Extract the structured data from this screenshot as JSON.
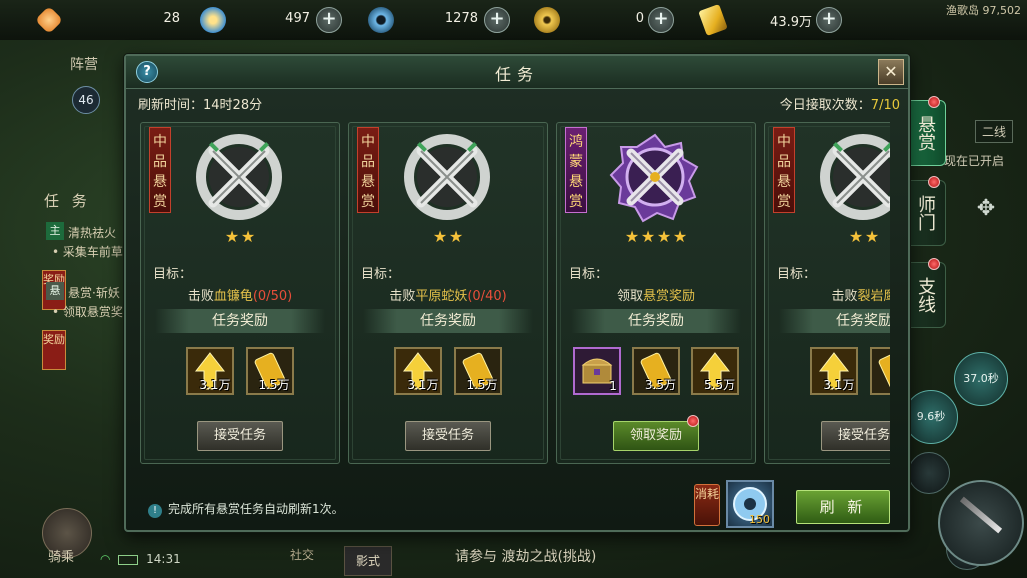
{
  "topbar": {
    "resources": [
      {
        "icon": "orange-crystal-icon",
        "value": "28",
        "color": "#f0a040"
      },
      {
        "icon": "gold-swirl-icon",
        "value": "497",
        "color": "#3f8fd0"
      },
      {
        "icon": "jade-disc-icon",
        "value": "1278",
        "color": "#6fb8e8"
      },
      {
        "icon": "coin-icon",
        "value": "0",
        "color": "#d8a832"
      },
      {
        "icon": "gold-ticket-icon",
        "value": "43.9万",
        "color": "#e6b020"
      }
    ],
    "map_name": "渔歌岛 97,502"
  },
  "hud_left": {
    "team_label": "阵营",
    "level": "46",
    "task_tab": "任 务",
    "quests": [
      {
        "badge": "主",
        "text": "清热祛火"
      },
      {
        "text": "• 采集车前草"
      },
      {
        "badge": "悬",
        "text": "悬赏·斩妖"
      },
      {
        "text": "• 领取悬赏奖"
      }
    ],
    "reward_tag": "奖励",
    "mount_label": "骑乘",
    "time": "14:31",
    "social": "社交",
    "shadow": "影式",
    "invite": "请参与 渡劫之战(挑战)"
  },
  "hud_right": {
    "line_label": "二线",
    "opened_text": "现在已开启",
    "cooldowns": [
      "37.0秒",
      "9.6秒"
    ]
  },
  "side_tabs": [
    {
      "label": "悬赏",
      "active": true
    },
    {
      "label": "师门",
      "active": false
    },
    {
      "label": "支线",
      "active": false
    }
  ],
  "dialog": {
    "title": "任务",
    "refresh_time": "刷新时间：14时28分",
    "accept_count_label": "今日接取次数：",
    "accept_count_value": "7/10",
    "target_label": "目标：",
    "reward_title": "任务奖励",
    "cards": [
      {
        "grade": "中品悬赏",
        "stars": 2,
        "emblem": "silver-crossed-swords-emblem",
        "action": "击败",
        "target": "血镰龟",
        "progress": "(0/50)",
        "rewards": [
          {
            "icon": "exp-arrow-icon",
            "count": "3.1万"
          },
          {
            "icon": "gold-ticket-icon",
            "count": "1.5万"
          }
        ],
        "button": "接受任务"
      },
      {
        "grade": "中品悬赏",
        "stars": 2,
        "emblem": "silver-crossed-swords-emblem",
        "action": "击败",
        "target": "平原蛇妖",
        "progress": "(0/40)",
        "rewards": [
          {
            "icon": "exp-arrow-icon",
            "count": "3.1万"
          },
          {
            "icon": "gold-ticket-icon",
            "count": "1.5万"
          }
        ],
        "button": "接受任务"
      },
      {
        "grade": "鸿蒙悬赏",
        "stars": 4,
        "emblem": "purple-crossed-swords-emblem",
        "action": "领取",
        "target": "悬赏奖励",
        "progress": "",
        "rewards": [
          {
            "icon": "treasure-chest-icon",
            "count": "1"
          },
          {
            "icon": "gold-ticket-icon",
            "count": "3.5万"
          },
          {
            "icon": "exp-arrow-icon",
            "count": "5.5万"
          }
        ],
        "button": "领取奖励"
      },
      {
        "grade": "中品悬赏",
        "stars": 2,
        "emblem": "silver-crossed-swords-emblem",
        "action": "击败",
        "target": "裂岩鹰",
        "progress": "",
        "rewards": [
          {
            "icon": "exp-arrow-icon",
            "count": "3.1万"
          },
          {
            "icon": "gold-ticket-icon",
            "count": ""
          }
        ],
        "button": "接受任务"
      }
    ],
    "footer_note": "完成所有悬赏任务自动刷新1次。",
    "consume_label": "消耗",
    "consume_count": "150",
    "refresh_button": "刷 新"
  }
}
